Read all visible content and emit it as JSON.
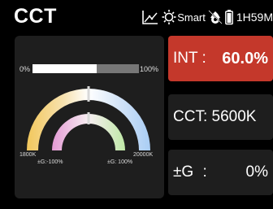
{
  "header": {
    "title": "CCT",
    "smart_label": "Smart",
    "battery_text": "1H59M"
  },
  "intensity_bar": {
    "min_label": "0%",
    "max_label": "100%",
    "level": 0.6
  },
  "arc_labels": {
    "cct_min": "1800K",
    "cct_max": "20000K",
    "g_min": "±G:-100%",
    "g_max": "±G: 100%"
  },
  "params": {
    "int_label": "INT",
    "int_sep": ":",
    "int_value": "60.0%",
    "cct_label": "CCT: 5600K",
    "g_label": "±G",
    "g_sep": ":",
    "g_value": "0%"
  },
  "colors": {
    "accent": "#c4382b",
    "panel": "#1e1e1e",
    "warm": "#f2c75c",
    "cool": "#a9cdf4"
  },
  "icons": [
    "chart-icon",
    "smart-sun-icon",
    "gear-icon",
    "battery-icon"
  ]
}
